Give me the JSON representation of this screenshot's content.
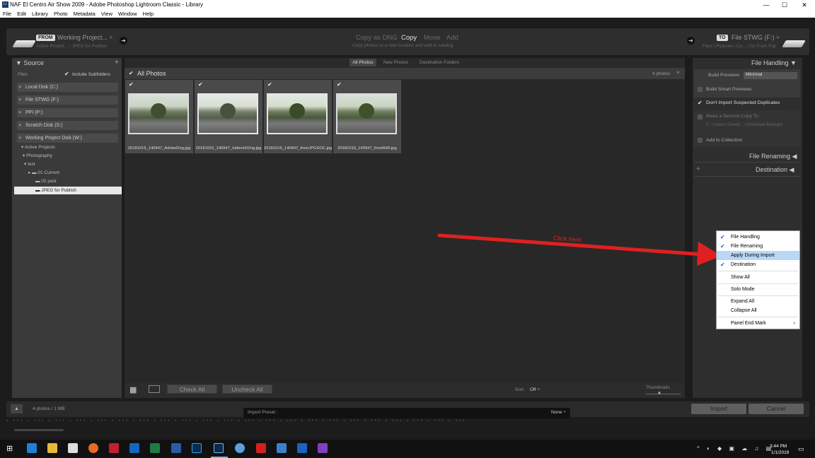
{
  "window": {
    "title": "NAF El Centro Air Show 2009 - Adobe Photoshop Lightroom Classic - Library",
    "minimize": "—",
    "maximize": "☐",
    "close": "✕"
  },
  "menubar": [
    "File",
    "Edit",
    "Library",
    "Photo",
    "Metadata",
    "View",
    "Window",
    "Help"
  ],
  "topbar": {
    "from_badge": "FROM",
    "from_title": "Working Project... ÷",
    "from_path": "Active Project... \\ JPEG for Publish",
    "modes": [
      "Copy as DNG",
      "Copy",
      "Move",
      "Add"
    ],
    "active_mode": "Copy",
    "mode_hint": "Copy photos to a new location and add to catalog",
    "to_badge": "TO",
    "to_title": "File STWG (F:) ÷",
    "to_path": "Files \\ Pictures \\ Co... \\ 02 From Fuji"
  },
  "source": {
    "header": "Source",
    "add_icon": "+",
    "files_label": "Files",
    "include_subfolders": "Include Subfolders",
    "drives": [
      "Local Disk (C:)",
      "File STWG (F:)",
      "PPI (P:)",
      "Scratch Disk (S:)",
      "Working Project Disk (W:)"
    ],
    "tree": [
      "Active Projects",
      "Photography",
      "test",
      "01 Current",
      "02 past",
      "JPEG for Publish"
    ]
  },
  "grid": {
    "tabs": [
      "All Photos",
      "New Photos",
      "Destination Folders"
    ],
    "header_title": "All Photos",
    "count": "4 photos",
    "photos": [
      "20181016_140947_AdobeDng.jpg",
      "20181016_140947_IridientXDng.jpg",
      "20181016_140947_fromJPGSOC.jpg",
      "20181016_140947_fromRAF.jpg"
    ]
  },
  "toolbar": {
    "check_all": "Check All",
    "uncheck_all": "Uncheck All",
    "sort_label": "Sort:",
    "sort_value": "Off ÷",
    "thumbnails_label": "Thumbnails"
  },
  "right_panel": {
    "file_handling": "File Handling",
    "build_previews_label": "Build Previews",
    "build_previews_value": "Minimal",
    "build_smart": "Build Smart Previews",
    "dont_import_dupes": "Don't Import Suspected Duplicates",
    "second_copy": "Make a Second Copy To :",
    "second_copy_path": "C: \\ Users \\ David... \\ Download Backups",
    "add_collection": "Add to Collection",
    "file_renaming": "File Renaming",
    "destination": "Destination",
    "dest_plus": "+"
  },
  "annotation": {
    "label": "Click here",
    "color": "#e02020"
  },
  "context_menu": {
    "items": [
      {
        "label": "File Handling",
        "checked": true
      },
      {
        "label": "File Renaming",
        "checked": true
      },
      {
        "label": "Apply During Import",
        "checked": false,
        "highlighted": true
      },
      {
        "label": "Destination",
        "checked": true
      },
      {
        "label": "Show All",
        "checked": false
      },
      {
        "label": "Solo Mode",
        "checked": false
      },
      {
        "label": "Expand All",
        "checked": false
      },
      {
        "label": "Collapse All",
        "checked": false
      },
      {
        "label": "Panel End Mark",
        "checked": false,
        "submenu": true
      }
    ],
    "submenu_arrow": "›"
  },
  "bottom": {
    "status": "4 photos / 1 MB",
    "import_preset_label": "Import Preset :",
    "import_preset_value": "None ÷",
    "import_button": "Import",
    "cancel_button": "Cancel"
  },
  "taskbar": {
    "time": "3:44 PM",
    "date": "1/1/2019"
  }
}
